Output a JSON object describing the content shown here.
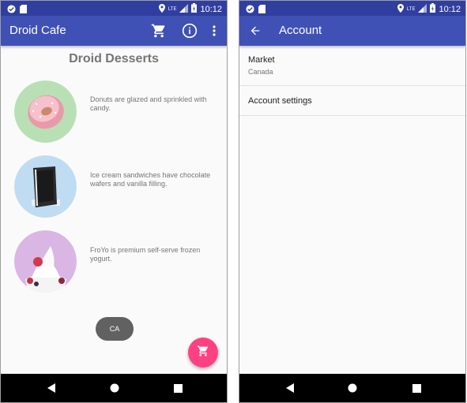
{
  "status_bar": {
    "time": "10:12",
    "network_label": "LTE"
  },
  "left": {
    "app_title": "Droid Cafe",
    "heading": "Droid Desserts",
    "desserts": [
      {
        "name": "donut",
        "description": "Donuts are glazed and sprinkled with candy."
      },
      {
        "name": "ice-cream-sandwich",
        "description": "Ice cream sandwiches have chocolate wafers and vanilla filling."
      },
      {
        "name": "froyo",
        "description": "FroYo is premium self-serve frozen yogurt."
      }
    ],
    "toast": "CA"
  },
  "right": {
    "app_title": "Account",
    "preferences": [
      {
        "title": "Market",
        "summary": "Canada"
      },
      {
        "title": "Account settings"
      }
    ]
  },
  "icons": {
    "status": [
      "notification-icon",
      "sd-card-icon",
      "location-icon",
      "signal-icon",
      "battery-icon"
    ],
    "toolbar": [
      "cart-icon",
      "info-icon",
      "overflow-menu-icon"
    ],
    "fab": "cart-icon",
    "back": "arrow-back-icon",
    "nav": [
      "back-nav-icon",
      "home-nav-icon",
      "recents-nav-icon"
    ]
  },
  "colors": {
    "primary": "#3f51b5",
    "primary_dark": "#303f9f",
    "accent": "#ff4081",
    "toast": "#616161"
  }
}
